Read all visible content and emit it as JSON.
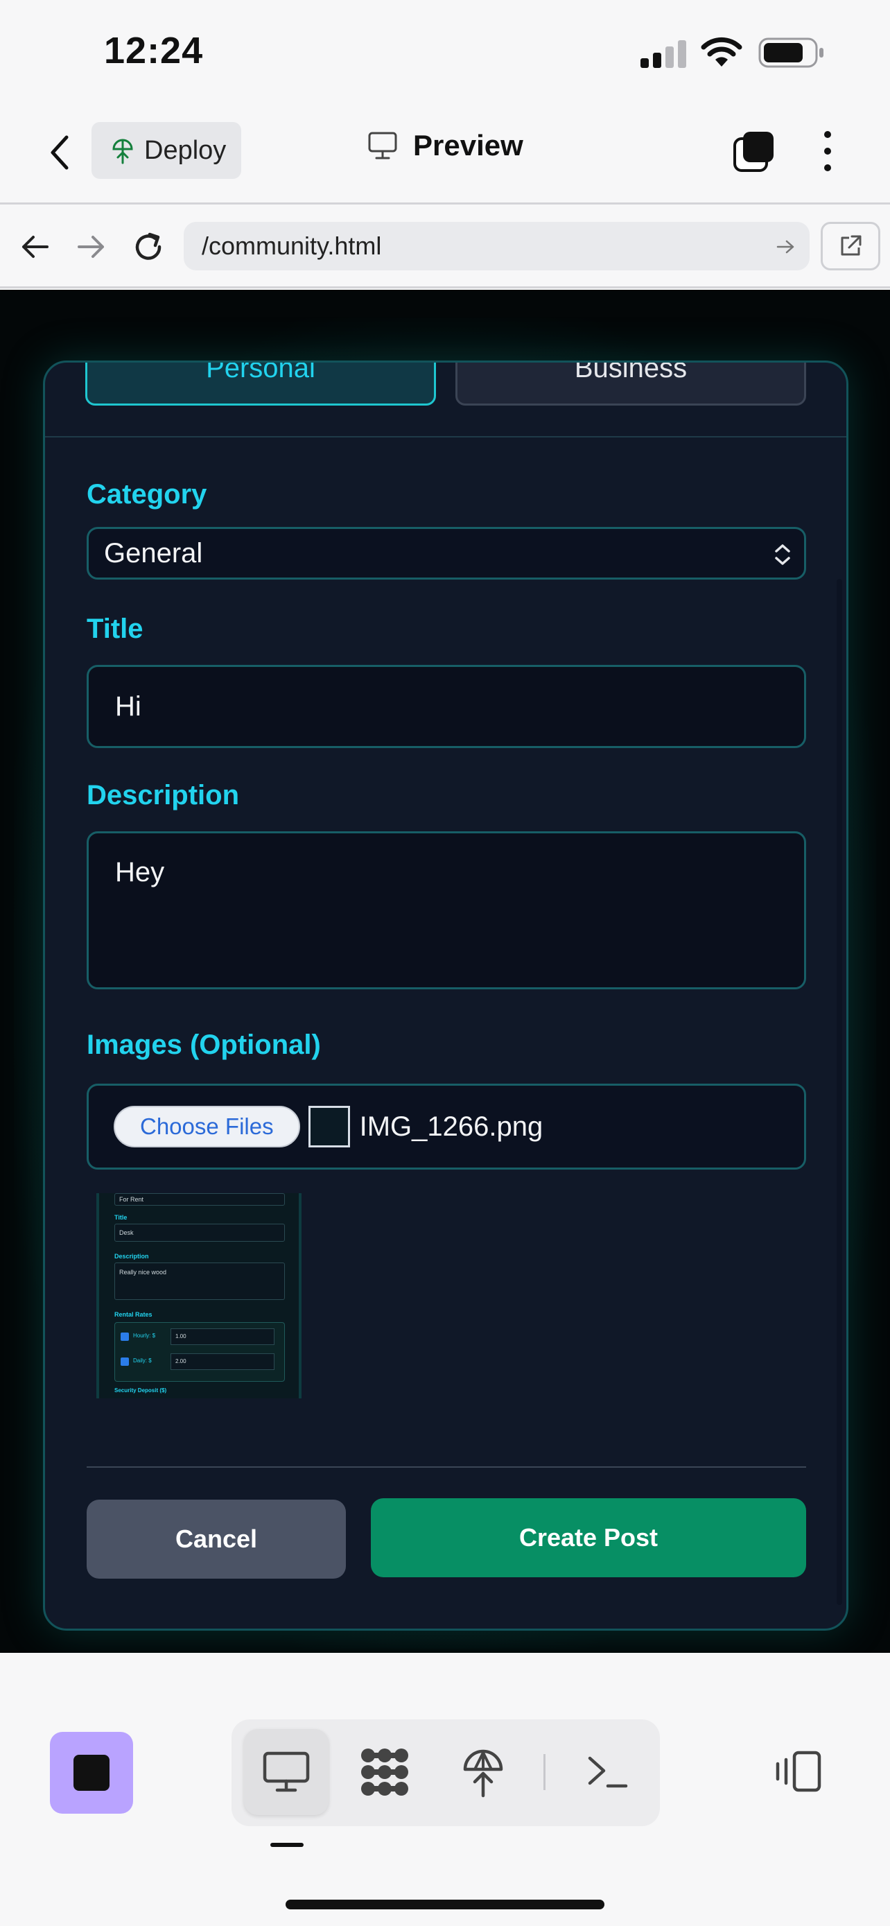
{
  "status_bar": {
    "time": "12:24"
  },
  "header": {
    "deploy_label": "Deploy",
    "preview_label": "Preview"
  },
  "browser": {
    "url": "/community.html"
  },
  "form": {
    "tabs": {
      "personal": "Personal",
      "business": "Business"
    },
    "category": {
      "label": "Category",
      "value": "General"
    },
    "title": {
      "label": "Title",
      "value": "Hi"
    },
    "description": {
      "label": "Description",
      "value": "Hey"
    },
    "images": {
      "label": "Images (Optional)",
      "choose_label": "Choose Files",
      "file_name": "IMG_1266.png"
    },
    "preview": {
      "select_value": "For Rent",
      "title_label": "Title",
      "title_value": "Desk",
      "description_label": "Description",
      "description_value": "Really nice wood",
      "rental_label": "Rental Rates",
      "hourly_label": "Hourly: $",
      "hourly_value": "1.00",
      "daily_label": "Daily: $",
      "daily_value": "2.00",
      "deposit_label": "Security Deposit ($)"
    },
    "cancel_label": "Cancel",
    "create_label": "Create Post"
  },
  "colors": {
    "accent": "#22d3ee",
    "primary_button": "#078f64",
    "secondary_button": "#4b5365",
    "card_bg": "#101828",
    "stop_button": "#b9a3ff"
  }
}
